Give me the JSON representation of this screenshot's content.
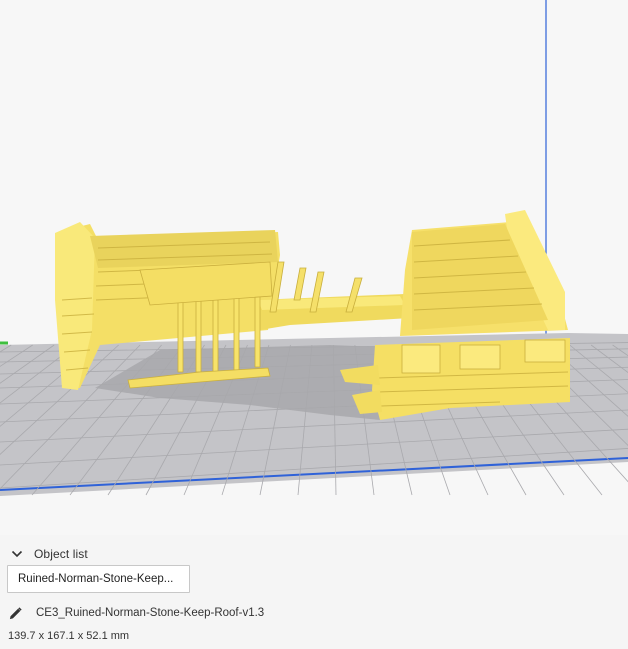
{
  "viewport": {
    "model_color": "#f7e36a",
    "model_shade": "#d9c24a",
    "model_dark": "#b9a03a",
    "plate_color": "#c4c4c8",
    "grid_color": "#aaaaae",
    "shadow_color": "#a4a4a8",
    "axis_blue": "#2f62d8",
    "axis_green": "#3fbf3f"
  },
  "panel": {
    "object_list_label": "Object list",
    "object_list_item": "Ruined-Norman-Stone-Keep...",
    "object_name": "CE3_Ruined-Norman-Stone-Keep-Roof-v1.3",
    "dimensions": "139.7 x 167.1 x 52.1 mm",
    "icons": {
      "collapse": "chevron-down-icon",
      "edit": "pencil-icon"
    }
  }
}
